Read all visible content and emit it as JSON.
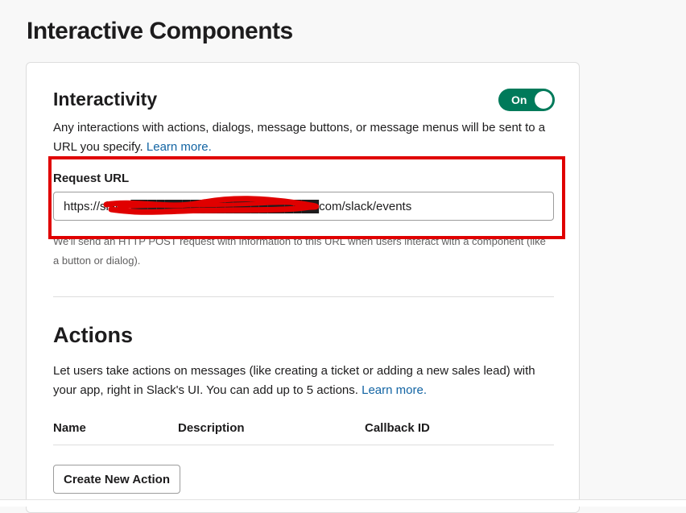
{
  "page": {
    "title": "Interactive Components"
  },
  "interactivity": {
    "title": "Interactivity",
    "toggle_label": "On",
    "description": "Any interactions with actions, dialogs, message buttons, or message menus will be sent to a URL you specify.",
    "learn_more": "Learn more.",
    "request_url": {
      "label": "Request URL",
      "value": "https://slack.██████████████████████com/slack/events",
      "help": "We'll send an HTTP POST request with information to this URL when users interact with a component (like a button or dialog)."
    }
  },
  "actions": {
    "title": "Actions",
    "description": "Let users take actions on messages (like creating a ticket or adding a new sales lead) with your app, right in Slack's UI. You can add up to 5 actions.",
    "learn_more": "Learn more.",
    "columns": [
      "Name",
      "Description",
      "Callback ID"
    ],
    "create_button": "Create New Action"
  },
  "colors": {
    "toggle_on": "#007a5a",
    "link": "#1264a3",
    "highlight": "#e00000",
    "redaction": "#e00000"
  }
}
